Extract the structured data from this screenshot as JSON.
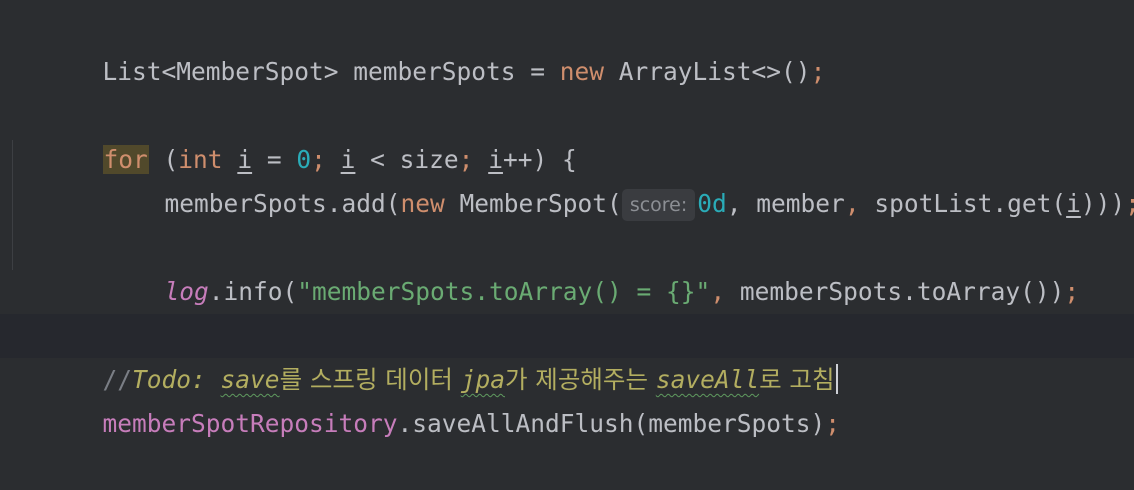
{
  "editor": {
    "lines": [
      {
        "id": "line-list-decl",
        "tokens": [
          "List<MemberSpot> memberSpots = ",
          "new",
          " ArrayList<>()",
          ";"
        ]
      },
      {
        "id": "line-for",
        "tokens": [
          "for",
          " (",
          "int",
          " ",
          "i",
          " = ",
          "0",
          "; ",
          "i",
          " < size",
          "; ",
          "i",
          "++) {"
        ]
      },
      {
        "id": "line-add",
        "tokens": [
          "memberSpots.add(",
          "new",
          " MemberSpot(",
          "score:",
          "0d",
          ", member",
          ", ",
          "spotList.get(",
          "i",
          "))",
          ")",
          ";"
        ]
      },
      {
        "id": "line-log",
        "tokens": [
          "log",
          ".info(",
          "\"memberSpots.toArray() = {}\"",
          ", ",
          "memberSpots.toArray())",
          ";"
        ]
      },
      {
        "id": "line-close",
        "tokens": [
          "}"
        ]
      },
      {
        "id": "line-todo",
        "tokens": [
          "//",
          "Todo: ",
          "save",
          "를 스프링 데이터 ",
          "jpa",
          "가 제공해주는 ",
          "saveAll",
          "로 고침"
        ]
      },
      {
        "id": "line-save",
        "tokens": [
          "memberSpotRepository",
          ".saveAllAndFlush(memberSpots)",
          ";"
        ]
      }
    ]
  },
  "colors": {
    "background": "#2b2d30",
    "keyword": "#cf8e6d",
    "number": "#2aacb8",
    "string": "#6aab73",
    "field": "#c77dbb",
    "todo": "#b3ae60",
    "comment": "#7a7e85",
    "default_text": "#bcbec4"
  }
}
